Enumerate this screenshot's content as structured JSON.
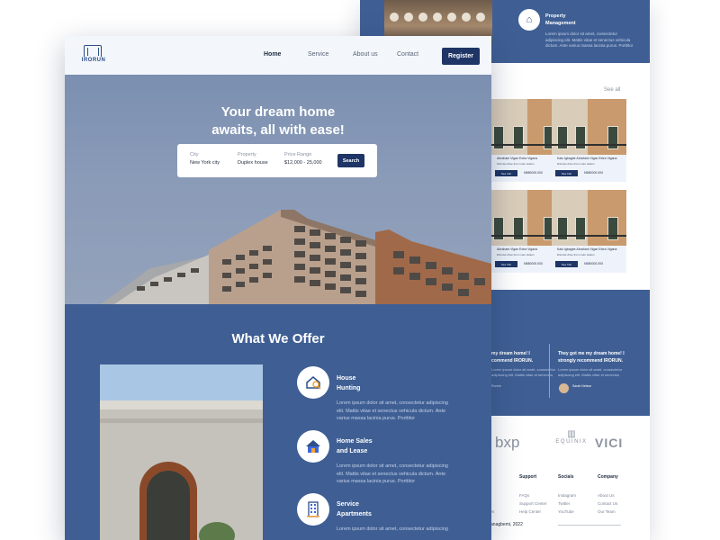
{
  "front": {
    "logo_text": "IRORUN",
    "nav": [
      "Home",
      "Service",
      "About us",
      "Contact"
    ],
    "register": "Register",
    "hero_title_1": "Your dream home",
    "hero_title_2": "awaits, all with ease!",
    "search": {
      "city_label": "City",
      "city_value": "New York city",
      "property_label": "Property",
      "property_value": "Duplex house",
      "price_label": "Price Range",
      "price_value": "$12,000 - 25,000",
      "button": "Search"
    },
    "offer_title": "What We Offer",
    "services": [
      {
        "title_1": "House",
        "title_2": "Hunting",
        "icon": "house-search-icon",
        "text_1": "Lorem ipsum dolor sit amet, consectetur adipiscing",
        "text_2": "elit. Mattis vitae et senectus vehicula dictum. Ante",
        "text_3": "varius massa lacinia purus. Porttitor"
      },
      {
        "title_1": "Home Sales",
        "title_2": "and Lease",
        "icon": "home-sale-icon",
        "text_1": "Lorem ipsum dolor sit amet, consectetur adipiscing",
        "text_2": "elit. Mattis vitae et senectus vehicula dictum. Ante",
        "text_3": "varius massa lacinia purus. Porttitor"
      },
      {
        "title_1": "Service",
        "title_2": "Apartments",
        "icon": "apartment-icon",
        "text_1": "Lorem ipsum dolor sit amet, consectetur adipiscing",
        "text_2": "",
        "text_3": ""
      }
    ]
  },
  "back": {
    "pm_title_1": "Property",
    "pm_title_2": "Management",
    "pm_text": "Lorem ipsum dolor sit amet, consectetur adipiscing elit. Mattis vitae et senectus vehicula dictum. Ante varius massa lacinia purus. Porttitor",
    "see_all": "See all",
    "listings": [
      {
        "title": "Abraham Vigan Extra Vigana",
        "meta": "Dismiss drive from main station",
        "button": "See Info",
        "price": "N580000.000"
      },
      {
        "title": "Kalu Igbagbe Abraham Vigan Extra Vigana",
        "meta": "Dismiss drive from main station",
        "button": "See Info",
        "price": "N580000.000"
      },
      {
        "title": "Abraham Vigan Extra Vigana",
        "meta": "Dismiss drive from main station",
        "button": "See Info",
        "price": "N580000.000"
      },
      {
        "title": "Kalu Igbagbe Abraham Vigan Extra Vigana",
        "meta": "Dismiss drive from main station",
        "button": "See Info",
        "price": "N580000.000"
      }
    ],
    "testimonial_1_a": "my dream home! I",
    "testimonial_1_b": "commend IRORUN.",
    "testimonial_2_a": "They got me my dream home! I",
    "testimonial_2_b": "strongly recommend IRORUN.",
    "testimonial_text": "Lorem ipsum dolor sit amet, consectetur adipiscing elit. Mattis vitae et senectus",
    "reviewer_1": "Ronnie",
    "reviewer_2": "Sarah Nelson",
    "partner_logos": [
      "bxp",
      "EQUINIX",
      "VICI"
    ],
    "footer": {
      "support_head": "Support",
      "socials_head": "Socials",
      "company_head": "Company",
      "support_links": [
        "FAQs",
        "Support Center",
        "Help Center"
      ],
      "socials_links": [
        "Instagram",
        "Twitter",
        "YouTube"
      ],
      "company_links": [
        "About Us",
        "Contact Us",
        "Our Team"
      ],
      "partial_links": [
        "ie",
        "ts",
        "ues"
      ],
      "copyright": "o Adanagbemi, 2022"
    }
  }
}
